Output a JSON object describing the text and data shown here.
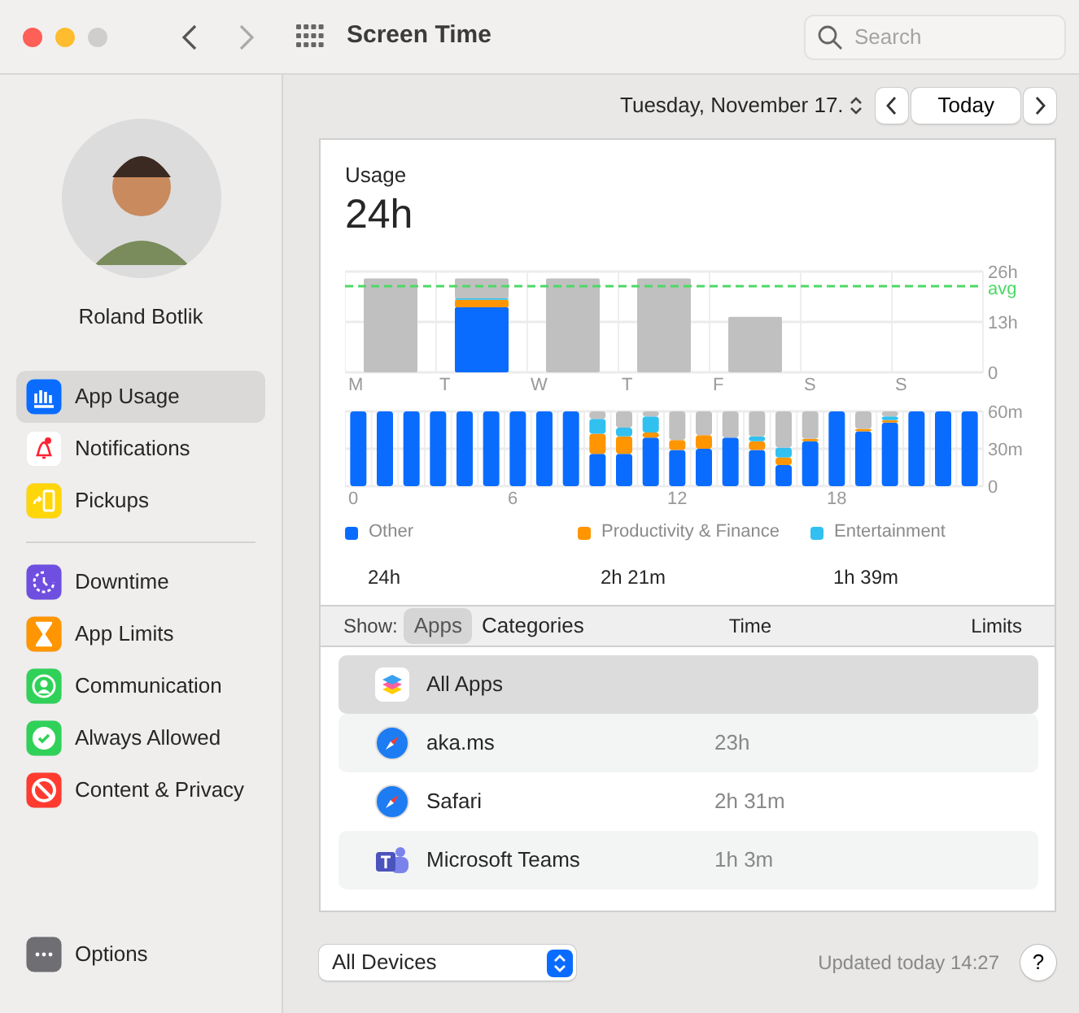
{
  "window": {
    "title": "Screen Time"
  },
  "toolbar": {
    "search": {
      "placeholder": "Search"
    }
  },
  "user": {
    "name": "Roland Botlik"
  },
  "sidebar": {
    "groups": [
      [
        {
          "label": "App Usage",
          "kind": "usage",
          "selected": true
        },
        {
          "label": "Notifications",
          "kind": "bell",
          "selected": false
        },
        {
          "label": "Pickups",
          "kind": "pickup",
          "selected": false
        }
      ],
      [
        {
          "label": "Downtime",
          "kind": "downtime",
          "selected": false
        },
        {
          "label": "App Limits",
          "kind": "hourglass",
          "selected": false
        },
        {
          "label": "Communication",
          "kind": "person",
          "selected": false
        },
        {
          "label": "Always Allowed",
          "kind": "check",
          "selected": false
        },
        {
          "label": "Content & Privacy",
          "kind": "block",
          "selected": false
        }
      ]
    ],
    "footer": {
      "label": "Options",
      "kind": "more",
      "selected": false
    }
  },
  "date_bar": {
    "date": "Tuesday, November 17.",
    "today": "Today"
  },
  "usage": {
    "title": "Usage",
    "total": "24h",
    "weekly_chart": {
      "chart_data": {
        "type": "bar",
        "stacked": true,
        "categories": [
          "M",
          "T",
          "W",
          "T",
          "F",
          "S",
          "S"
        ],
        "ylim": [
          0,
          26
        ],
        "yticks": [
          {
            "value": 0,
            "label": "0"
          },
          {
            "value": 13,
            "label": "13h"
          },
          {
            "value": 26,
            "label": "26h"
          }
        ],
        "series": [
          {
            "color": "#0a6cff",
            "values": [
              0,
              16.8,
              0,
              0,
              0,
              0,
              0
            ]
          },
          {
            "color": "#ff9500",
            "values": [
              0,
              1.9,
              0,
              0,
              0,
              0,
              0
            ]
          },
          {
            "color": "#32c0f0",
            "values": [
              0,
              0.4,
              0,
              0,
              0,
              0,
              0
            ]
          },
          {
            "color": "#c0c0c0",
            "values": [
              24.2,
              5.1,
              24.2,
              24.2,
              14.3,
              0,
              0
            ]
          }
        ],
        "ref_lines": [
          {
            "axis": "y",
            "value": 22.2,
            "label": "avg",
            "color": "#4cd964"
          }
        ]
      }
    },
    "hourly_chart": {
      "chart_data": {
        "type": "bar",
        "stacked": true,
        "x": [
          0,
          1,
          2,
          3,
          4,
          5,
          6,
          7,
          8,
          9,
          10,
          11,
          12,
          13,
          14,
          15,
          16,
          17,
          18,
          19,
          20,
          21,
          22,
          23
        ],
        "xlim": [
          -0.5,
          23.5
        ],
        "xticks": [
          0,
          6,
          12,
          18
        ],
        "ylim": [
          0,
          60
        ],
        "yticks": [
          {
            "value": 0,
            "label": "0"
          },
          {
            "value": 30,
            "label": "30m"
          },
          {
            "value": 60,
            "label": "60m"
          }
        ],
        "series": [
          {
            "name": "Other",
            "color": "#0a6cff",
            "values": [
              60,
              60,
              60,
              60,
              60,
              60,
              60,
              60,
              60,
              26,
              26,
              39,
              29,
              30,
              39,
              29,
              17,
              36,
              60,
              44,
              51,
              60,
              60,
              60
            ]
          },
          {
            "name": "Productivity & Finance",
            "color": "#ff9500",
            "values": [
              0,
              0,
              0,
              0,
              0,
              0,
              0,
              0,
              0,
              16,
              14,
              4,
              8,
              11,
              0,
              7,
              6,
              2,
              0,
              2,
              2,
              0,
              0,
              0
            ]
          },
          {
            "name": "Entertainment",
            "color": "#32c0f0",
            "values": [
              0,
              0,
              0,
              0,
              0,
              0,
              0,
              0,
              0,
              12,
              7,
              13,
              0,
              0,
              0,
              4,
              8,
              0,
              0,
              0,
              3,
              0,
              0,
              0
            ]
          },
          {
            "color": "#c0c0c0",
            "values": [
              0,
              0,
              0,
              0,
              0,
              0,
              0,
              0,
              0,
              6,
              13,
              4,
              23,
              19,
              21,
              20,
              29,
              22,
              0,
              14,
              4,
              0,
              0,
              0
            ]
          }
        ]
      }
    },
    "legend_totals": [
      "24h",
      "2h 21m",
      "1h 39m"
    ]
  },
  "table": {
    "show_label": "Show:",
    "segments": [
      {
        "label": "Apps",
        "selected": true
      },
      {
        "label": "Categories",
        "selected": false
      }
    ],
    "columns": [
      "Time",
      "Limits"
    ],
    "rows": [
      {
        "name": "All Apps",
        "kind": "all",
        "selected": true
      },
      {
        "name": "aka.ms",
        "time": "23h",
        "kind": "compass",
        "selected": false
      },
      {
        "name": "Safari",
        "time": "2h 31m",
        "kind": "compass",
        "selected": false
      },
      {
        "name": "Microsoft Teams",
        "time": "1h 3m",
        "kind": "teams",
        "selected": false
      }
    ]
  },
  "footer": {
    "device": "All Devices",
    "updated": "Updated today 14:27",
    "help": "?"
  }
}
